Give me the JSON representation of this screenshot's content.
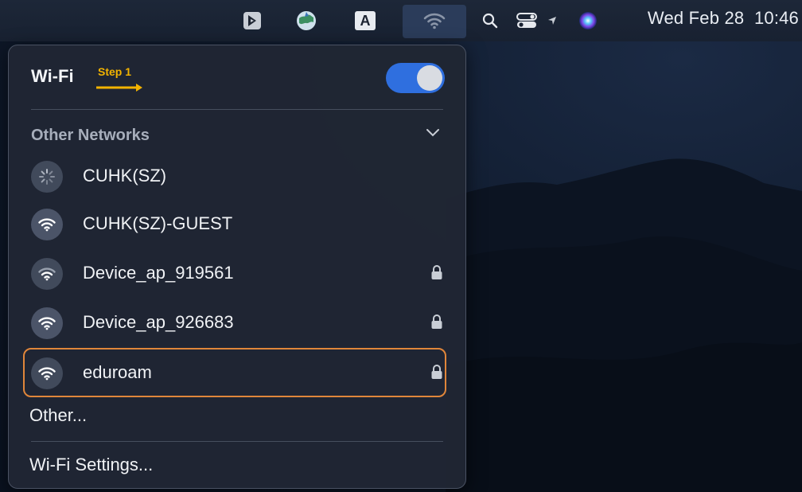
{
  "menubar": {
    "icons": [
      "kite-icon",
      "globe-app-icon",
      "input-source-icon",
      "wifi-icon",
      "search-icon",
      "control-center-icon",
      "location-arrow-icon",
      "siri-icon"
    ],
    "input_source_letter": "A",
    "clock": "Wed Feb 28  10:46"
  },
  "wifi_panel": {
    "title": "Wi-Fi",
    "annotation": "Step 1",
    "toggle_on": true,
    "section_title": "Other Networks",
    "networks": [
      {
        "name": "CUHK(SZ)",
        "icon": "loading-spinner-icon",
        "locked": false
      },
      {
        "name": "CUHK(SZ)-GUEST",
        "icon": "wifi-icon",
        "locked": false
      },
      {
        "name": "Device_ap_919561",
        "icon": "wifi-icon",
        "locked": true
      },
      {
        "name": "Device_ap_926683",
        "icon": "wifi-icon",
        "locked": true
      },
      {
        "name": "eduroam",
        "icon": "wifi-icon",
        "locked": true
      }
    ],
    "other_label": "Other...",
    "settings_label": "Wi-Fi Settings..."
  },
  "colors": {
    "toggle_accent": "#2f6fdf",
    "annotation": "#f2b300",
    "highlight_border": "#e0863a"
  }
}
